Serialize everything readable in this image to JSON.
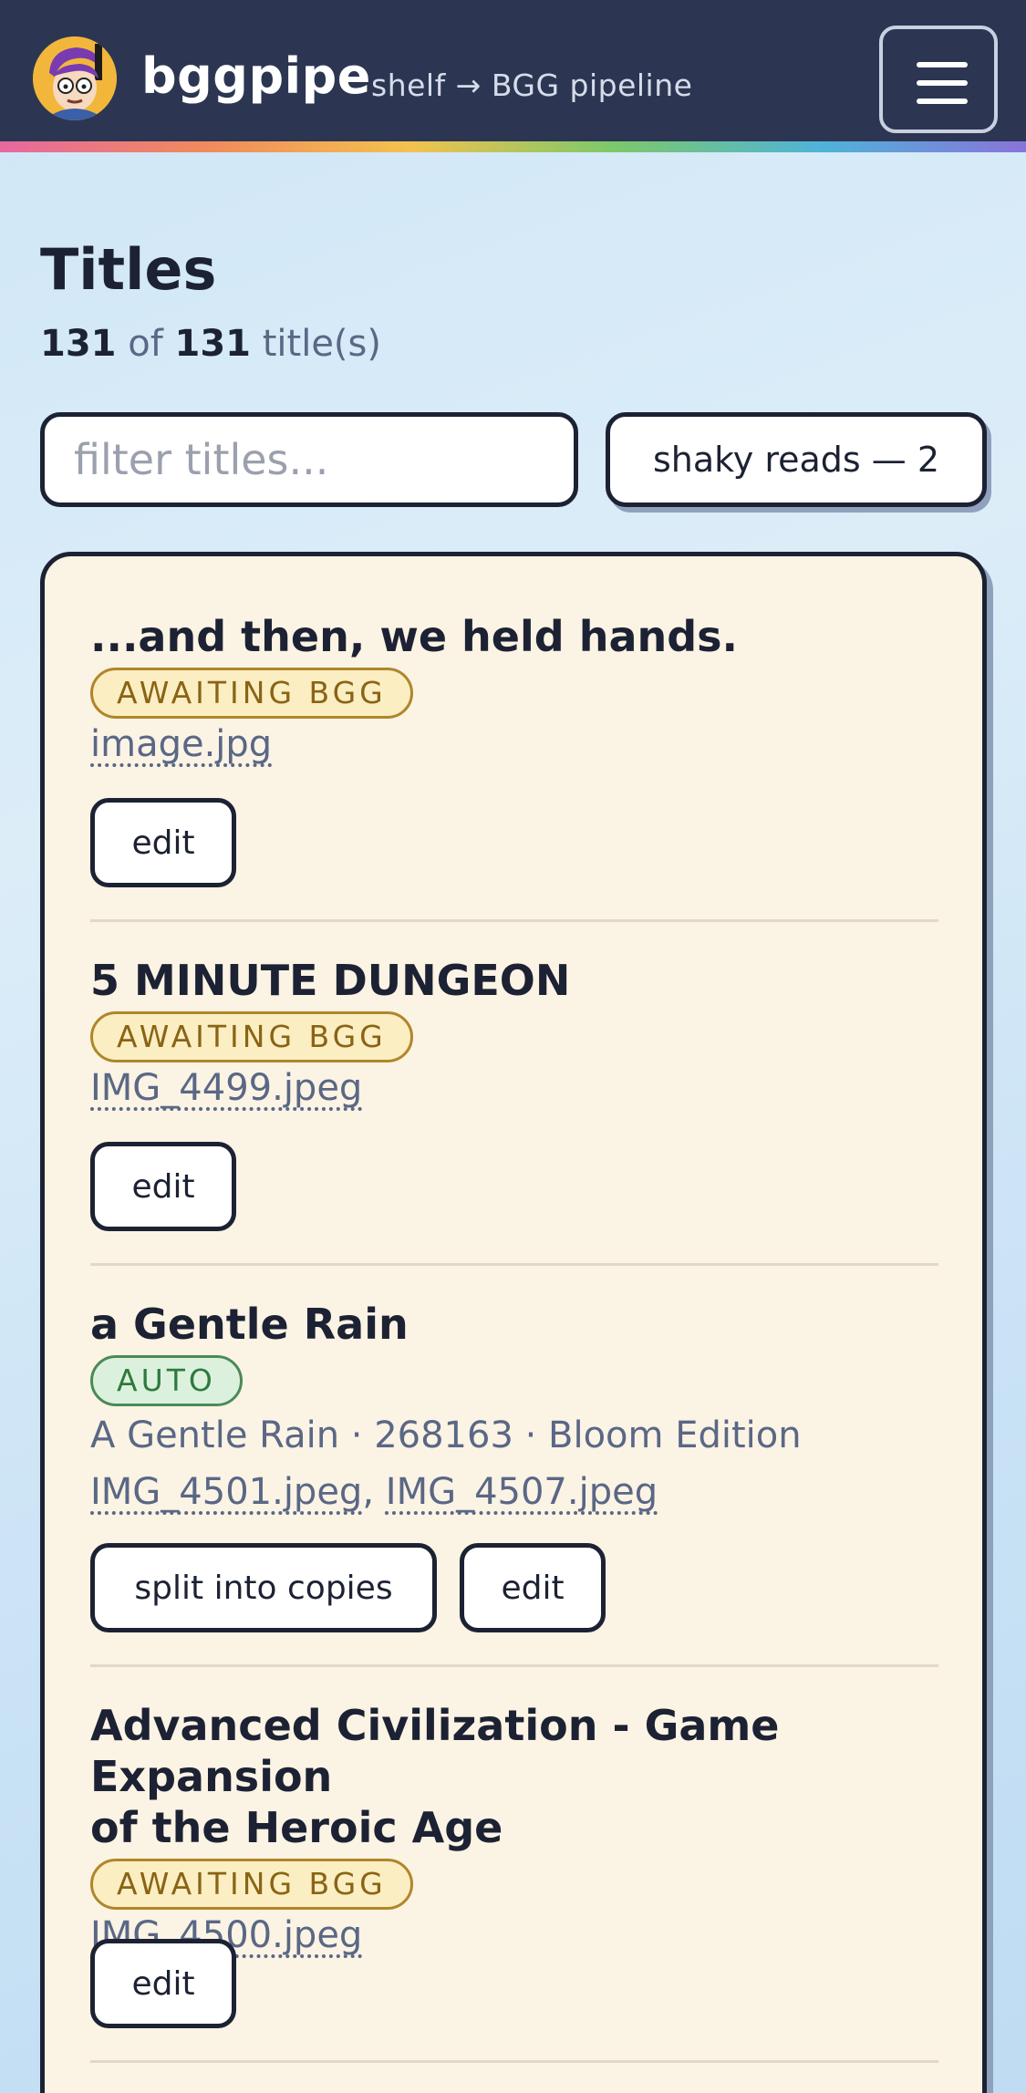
{
  "header": {
    "brand": "bggpipe",
    "tagline": "shelf → BGG pipeline",
    "avatar_icon": "avatar-cartoon-face",
    "menu_icon": "hamburger-menu-icon"
  },
  "page": {
    "title": "Titles",
    "count_shown": "131",
    "count_of": "of",
    "count_total": "131",
    "count_suffix": "title(s)"
  },
  "filter": {
    "placeholder": "filter titles...",
    "value": ""
  },
  "shaky_button": "shaky reads — 2",
  "entries": [
    {
      "title": "...and then, we held hands.",
      "status": "AWAITING BGG",
      "files": [
        "image.jpg"
      ],
      "actions": [
        "edit"
      ]
    },
    {
      "title": "5 MINUTE DUNGEON",
      "status": "AWAITING BGG",
      "files": [
        "IMG_4499.jpeg"
      ],
      "actions": [
        "edit"
      ]
    },
    {
      "title": "a Gentle Rain",
      "status": "AUTO",
      "match": "A Gentle Rain · 268163 · Bloom Edition",
      "files": [
        "IMG_4501.jpeg",
        "IMG_4507.jpeg"
      ],
      "actions": [
        "split into copies",
        "edit"
      ]
    },
    {
      "title_line1": "Advanced Civilization - Game Expansion",
      "title_line2": "of the Heroic Age",
      "status": "AWAITING BGG",
      "files": [
        "IMG_4500.jpeg"
      ],
      "actions": [
        "edit"
      ]
    }
  ],
  "colors": {
    "header_bg": "#2c3652",
    "card_bg": "#fbf3e4",
    "awaiting_badge": "#fbeec3",
    "auto_badge": "#dcf1dd"
  }
}
